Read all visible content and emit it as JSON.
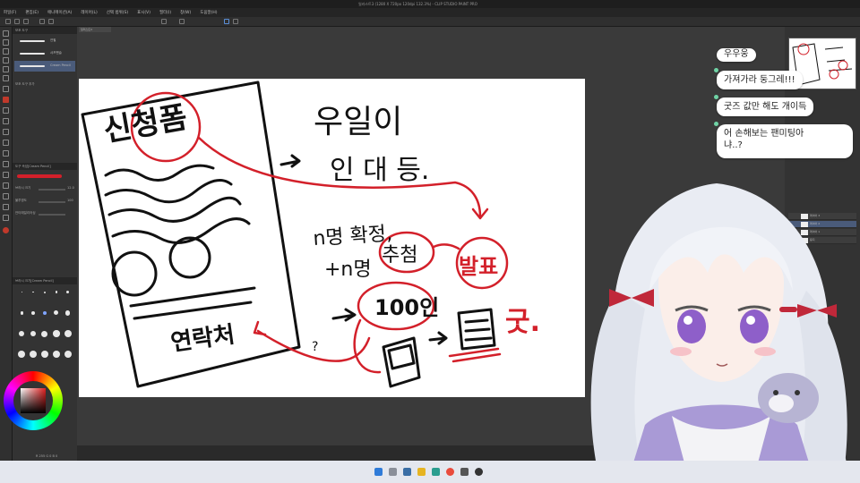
{
  "app": {
    "window_title": "일러스트3 (1280 X 720px 120dpi 132.3%) - CLIP STUDIO PAINT PRO",
    "menu": [
      "파일(F)",
      "편집(E)",
      "애니메이션(A)",
      "레이어(L)",
      "선택 범위(S)",
      "표시(V)",
      "필터(I)",
      "창(W)",
      "도움말(H)"
    ],
    "doc_tab": "일러스트3"
  },
  "left_panel": {
    "brush_header": "보조 도구",
    "brushes": [
      "연필",
      "샤프펜슬",
      "Cream Pencil"
    ],
    "brush_footer": "보조 도구 추가",
    "props_header": "도구 속성[Cream Pencil]",
    "props": [
      {
        "label": "브러시 크기",
        "value": "12.0"
      },
      {
        "label": "불투명도",
        "value": "100"
      },
      {
        "label": "안티에일리어싱",
        "value": ""
      }
    ],
    "size_header": "브러시 크기[Cream Pencil]",
    "size_dots": [
      "0.7",
      "1",
      "1.5",
      "2",
      "2.5",
      "3",
      "4",
      "5",
      "6",
      "7",
      "8",
      "10",
      "12",
      "15",
      "17",
      "20",
      "25",
      "30",
      "40",
      "50"
    ],
    "color_readout": "R 255 G 0 B 0"
  },
  "canvas": {
    "words": {
      "application_form": "신청폼",
      "contact": "연락처",
      "ui_etc_1": "우일이",
      "ui_etc_2": "인 대 등.",
      "n_confirm": "n명 확정,",
      "n_lottery": "+n명",
      "lottery": "추첨",
      "announce": "발표",
      "hundred": "100인",
      "goods": "굿."
    }
  },
  "right_panel": {
    "layers": [
      "레이어 3",
      "레이어 2",
      "레이어 1",
      "용지"
    ]
  },
  "chat": {
    "messages": [
      "우우웅",
      "가져가라 둥그레!!!",
      "굿즈 값만 해도 개이득",
      "어 손해보는 팬미팅아",
      "냐..?"
    ]
  },
  "colors": {
    "ink": "#111111",
    "red_ink": "#d3202a",
    "ui_dark": "#2b2b2b",
    "chat_bubble": "#ffffff",
    "chat_dot": "#6fd3a5"
  }
}
